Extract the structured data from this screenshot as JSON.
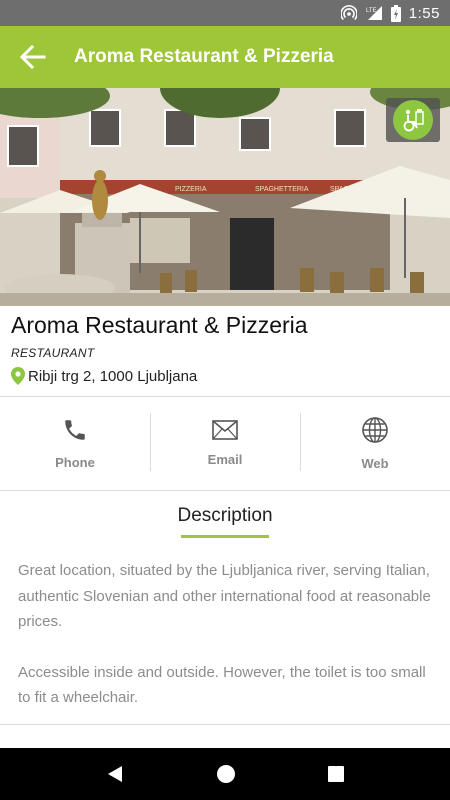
{
  "status_bar": {
    "time": "1:55",
    "network": "LTE"
  },
  "app_bar": {
    "title": "Aroma Restaurant & Pizzeria"
  },
  "hero": {
    "awning_text_1": "PIZZERIA",
    "awning_text_2": "SPAGHETTERIA",
    "awning_text_3": "SPAGHETTERIA"
  },
  "place": {
    "name": "Aroma Restaurant & Pizzeria",
    "type": "RESTAURANT",
    "address": "Ribji trg 2, 1000 Ljubljana"
  },
  "contacts": [
    {
      "label": "Phone",
      "icon": "phone-icon"
    },
    {
      "label": "Email",
      "icon": "email-icon"
    },
    {
      "label": "Web",
      "icon": "globe-icon"
    }
  ],
  "description": {
    "tab_label": "Description",
    "paragraph_1": "Great location, situated by the Ljubljanica river, serving Italian, authentic Slovenian and other international food at reasonable prices.",
    "paragraph_2": "Accessible inside and outside. However, the toilet is too small to fit a wheelchair."
  },
  "colors": {
    "accent": "#9fc639",
    "status_bar": "#6e6e6e",
    "nav_bar": "#000000"
  }
}
